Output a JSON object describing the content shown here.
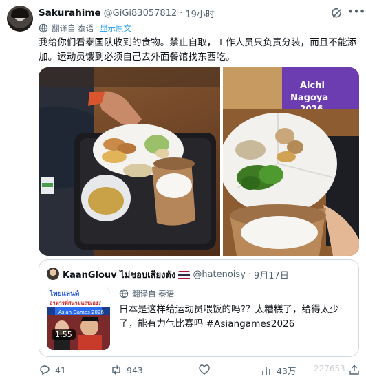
{
  "post": {
    "author_name": "Sakurahime",
    "author_handle": "@GiGi83057812",
    "separator": "·",
    "time": "19小时",
    "translate_label": "翻译自 泰语",
    "show_original": "显示原文",
    "text": "我给你们看泰国队收到的食物。禁止自取，工作人员只负责分装，而且不能添加。运动员饿到必须自己去外面餐馆找东西吃。",
    "photos": [
      "food-tray-photo",
      "food-plate-photo"
    ],
    "photo_sign_text": "Aichi Nagoya 2026"
  },
  "quote": {
    "author_name": "KaanGlouv ไม่ชอบเสียงดัง",
    "author_handle": "@hatenoisy",
    "separator": "·",
    "time": "9月17日",
    "translate_label": "翻译自 泰语",
    "text": "日本是这样给运动员喂饭的吗?？太糟糕了，给得太少了，能有力气比赛吗 #Asiangames2026",
    "video_duration": "1:55",
    "thumb_text_top": "ไทยแลนด์",
    "thumb_text_sub": "อาหารที่สนามแถบเอง?",
    "thumb_banner": "Asian Games 2026"
  },
  "actions": {
    "replies": "41",
    "reposts": "943",
    "likes": "",
    "views": "43万",
    "watermark": "227653",
    "colors": {
      "icon": "#536471",
      "accent": "#1d9bf0"
    }
  }
}
